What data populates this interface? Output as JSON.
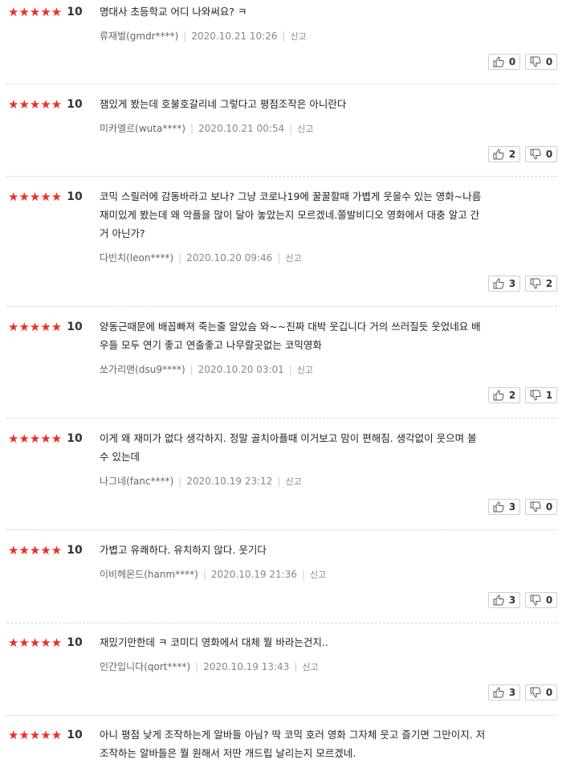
{
  "reviews": [
    {
      "stars": "★★★★★",
      "score": "10",
      "lines": [
        "명대사 초등학교 어디 나와써요? ㅋ"
      ],
      "author": "류재벌(gmdr****)",
      "date": "2020.10.21 10:26",
      "report": "신고",
      "like": "0",
      "dislike": "0"
    },
    {
      "stars": "★★★★★",
      "score": "10",
      "lines": [
        "잼있게 봤는데 호불호갈리네 그렇다고 평점조작은 아니란다"
      ],
      "author": "미카엘르(wuta****)",
      "date": "2020.10.21 00:54",
      "report": "신고",
      "like": "2",
      "dislike": "0"
    },
    {
      "stars": "★★★★★",
      "score": "10",
      "lines": [
        "코믹 스릴러에 감동바라고 보나? 그냥 코로나19에 꿀꿀할때 가볍게 웃을수 있는 영화~나름",
        "재미있게 봤는데 왜 악플을 많이 달아 놓았는지 모르겠네.쫄발비디오 영화에서 대충 알고 간",
        "거 아닌가?"
      ],
      "author": "다빈치(leon****)",
      "date": "2020.10.20 09:46",
      "report": "신고",
      "like": "3",
      "dislike": "2"
    },
    {
      "stars": "★★★★★",
      "score": "10",
      "lines": [
        "양동근때문에 배꼽빠져 죽는줄 알았슴 와~~진짜 대박 웃깁니다 거의 쓰러질듯 웃었네요 배",
        "우들 모두 연기 좋고 연출좋고 나무랄곳없는 코믹영화"
      ],
      "author": "쏘가리맨(dsu9****)",
      "date": "2020.10.20 03:01",
      "report": "신고",
      "like": "2",
      "dislike": "1"
    },
    {
      "stars": "★★★★★",
      "score": "10",
      "lines": [
        "이게 왜 재미가 없다 생각하지. 정말 골치아플때 이거보고 맘이 편해짐. 생각없이 웃으며 볼",
        "수 있는데"
      ],
      "author": "나그네(fanc****)",
      "date": "2020.10.19 23:12",
      "report": "신고",
      "like": "3",
      "dislike": "0"
    },
    {
      "stars": "★★★★★",
      "score": "10",
      "lines": [
        "가볍고 유쾌하다. 유치하지 않다. 웃기다"
      ],
      "author": "이비헤몬드(hanm****)",
      "date": "2020.10.19 21:36",
      "report": "신고",
      "like": "3",
      "dislike": "0"
    },
    {
      "stars": "★★★★★",
      "score": "10",
      "lines": [
        "재밌기만한데 ㅋ 코미디 영화에서 대체 뭘 바라는건지.."
      ],
      "author": "인간입니다(qort****)",
      "date": "2020.10.19 13:43",
      "report": "신고",
      "like": "3",
      "dislike": "0"
    },
    {
      "stars": "★★★★★",
      "score": "10",
      "lines": [
        "아니 평점 낮게 조작하는게 알바들 아님? 딱 코믹 호러 영화 그자체 웃고 즐기면 그만이지. 저",
        "조작하는 알바들은 뭘 원해서 저딴 개드립 날리는지 모르겠네."
      ],
      "author": "",
      "date": "",
      "report": "",
      "like": "",
      "dislike": ""
    }
  ]
}
